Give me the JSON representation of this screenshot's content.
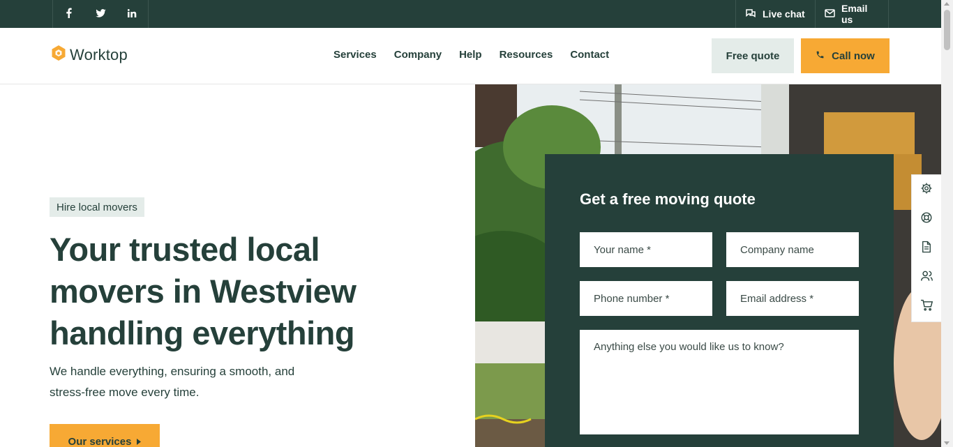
{
  "topbar": {
    "social": [
      {
        "icon": "facebook-icon",
        "glyph": "f"
      },
      {
        "icon": "twitter-icon",
        "glyph": "🐦"
      },
      {
        "icon": "linkedin-icon",
        "glyph": "in"
      }
    ],
    "live_chat": "Live chat",
    "email_us": "Email us"
  },
  "header": {
    "logo_text": "Worktop",
    "nav": [
      "Services",
      "Company",
      "Help",
      "Resources",
      "Contact"
    ],
    "free_quote": "Free quote",
    "call_now": "Call now"
  },
  "hero": {
    "badge": "Hire local movers",
    "title": "Your trusted local movers in Westview handling everything",
    "subtitle": "We handle everything, ensuring a smooth, and stress-free move every time.",
    "services_button": "Our services"
  },
  "quote_form": {
    "title": "Get a free moving quote",
    "name_placeholder": "Your name *",
    "company_placeholder": "Company name",
    "phone_placeholder": "Phone number *",
    "email_placeholder": "Email address *",
    "message_placeholder": "Anything else you would like us to know?"
  },
  "tools": [
    "gear-icon",
    "lifebuoy-icon",
    "document-icon",
    "users-icon",
    "cart-icon"
  ],
  "colors": {
    "dark_green": "#25403a",
    "orange": "#f7a934",
    "light_green": "#e4ece9"
  }
}
